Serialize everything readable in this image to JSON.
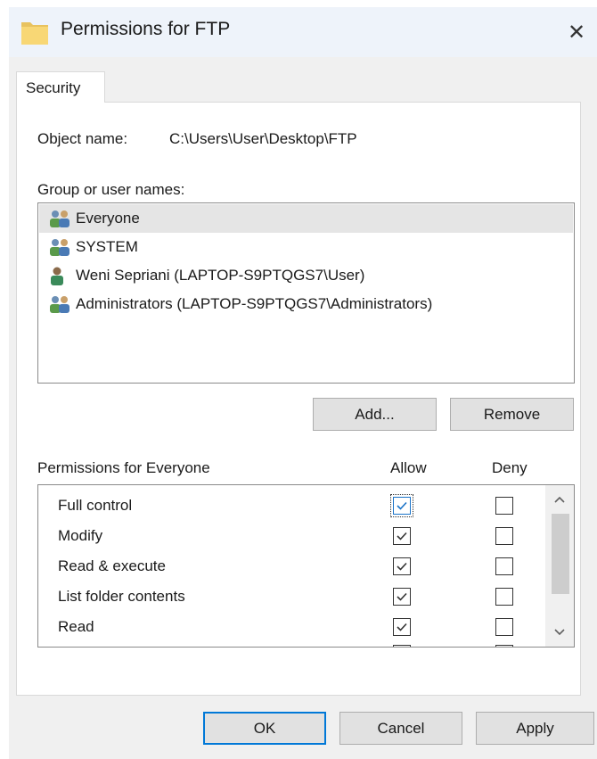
{
  "window": {
    "title": "Permissions for FTP",
    "close_glyph": "✕",
    "title_icon": "folder-icon"
  },
  "tabs": [
    {
      "label": "Security",
      "active": true
    }
  ],
  "object": {
    "label": "Object name:",
    "value": "C:\\Users\\User\\Desktop\\FTP"
  },
  "groups": {
    "label": "Group or user names:",
    "items": [
      {
        "name": "Everyone",
        "icon": "users-group-icon",
        "selected": true
      },
      {
        "name": "SYSTEM",
        "icon": "users-group-icon",
        "selected": false
      },
      {
        "name": "Weni Sepriani (LAPTOP-S9PTQGS7\\User)",
        "icon": "user-icon",
        "selected": false
      },
      {
        "name": "Administrators (LAPTOP-S9PTQGS7\\Administrators)",
        "icon": "users-group-icon",
        "selected": false
      }
    ]
  },
  "group_buttons": {
    "add_label": "Add...",
    "remove_label": "Remove"
  },
  "permissions": {
    "header": "Permissions for Everyone",
    "allow_label": "Allow",
    "deny_label": "Deny",
    "rows": [
      {
        "name": "Full control",
        "allow": true,
        "deny": false,
        "focused": true
      },
      {
        "name": "Modify",
        "allow": true,
        "deny": false,
        "focused": false
      },
      {
        "name": "Read & execute",
        "allow": true,
        "deny": false,
        "focused": false
      },
      {
        "name": "List folder contents",
        "allow": true,
        "deny": false,
        "focused": false
      },
      {
        "name": "Read",
        "allow": true,
        "deny": false,
        "focused": false
      }
    ]
  },
  "footer": {
    "ok_label": "OK",
    "cancel_label": "Cancel",
    "apply_label": "Apply"
  },
  "colors": {
    "titlebar_bg": "#eef3fa",
    "dialog_bg": "#f0f0f0",
    "accent": "#0078d7",
    "folder_yellow": "#f8d775"
  }
}
